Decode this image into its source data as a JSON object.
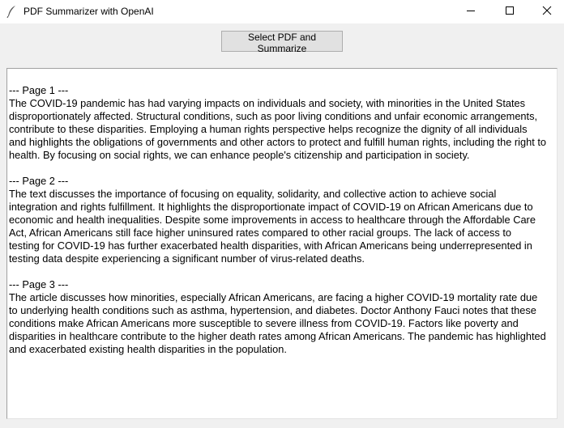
{
  "window": {
    "title": "PDF Summarizer with OpenAI",
    "icon": "feather-icon",
    "controls": [
      "minimize-icon",
      "maximize-icon",
      "close-icon"
    ]
  },
  "button": {
    "label": "Select PDF and Summarize"
  },
  "output": {
    "sections": [
      {
        "header": "--- Page 1 ---",
        "lines": [
          "The COVID-19 pandemic has had varying impacts on individuals and society, with minorities in the United States",
          "disproportionately affected. Structural conditions, such as poor living conditions and unfair economic arrangements,",
          "contribute to these disparities. Employing a human rights perspective helps recognize the dignity of all individuals",
          "and highlights the obligations of governments and other actors to protect and fulfill human rights, including the right to",
          "health. By focusing on social rights, we can enhance people's citizenship and participation in society."
        ]
      },
      {
        "header": "--- Page 2 ---",
        "lines": [
          "The text discusses the importance of focusing on equality, solidarity, and collective action to achieve social",
          "integration and rights fulfillment. It highlights the disproportionate impact of COVID-19 on African Americans due to",
          "economic and health inequalities. Despite some improvements in access to healthcare through the Affordable Care",
          "Act, African Americans still face higher uninsured rates compared to other racial groups. The lack of access to",
          "testing for COVID-19 has further exacerbated health disparities, with African Americans being underrepresented in",
          "testing data despite experiencing a significant number of virus-related deaths."
        ]
      },
      {
        "header": "--- Page 3 ---",
        "lines": [
          "The article discusses how minorities, especially African Americans, are facing a higher COVID-19 mortality rate due",
          "to underlying health conditions such as asthma, hypertension, and diabetes. Doctor Anthony Fauci notes that these",
          "conditions make African Americans more susceptible to severe illness from COVID-19. Factors like poverty and",
          "disparities in healthcare contribute to the higher death rates among African Americans. The pandemic has highlighted",
          "and exacerbated existing health disparities in the population."
        ]
      }
    ]
  }
}
